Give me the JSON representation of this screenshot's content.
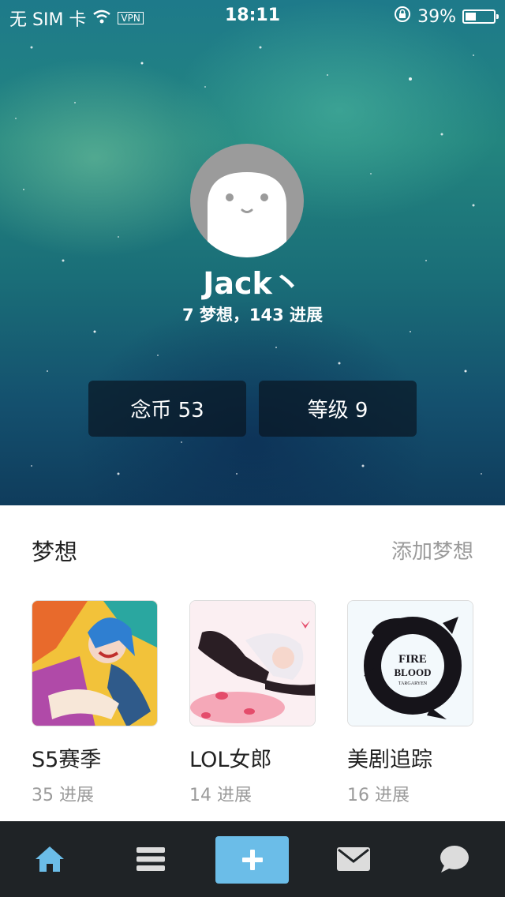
{
  "status_bar": {
    "carrier": "无 SIM 卡",
    "vpn": "VPN",
    "time": "18:11",
    "battery": "39%",
    "battery_level": 0.39
  },
  "profile": {
    "username": "Jack丶",
    "stats": "7 梦想，143 进展",
    "coins_button": "念币 53",
    "level_button": "等级 9"
  },
  "dreams_section": {
    "title": "梦想",
    "add_label": "添加梦想",
    "items": [
      {
        "title": "S5赛季",
        "progress": "35 进展",
        "image": "anime-character-art"
      },
      {
        "title": "LOL女郎",
        "progress": "14 进展",
        "image": "anime-girl-art"
      },
      {
        "title": "美剧追踪",
        "progress": "16 进展",
        "image": "targaryen-sigil"
      }
    ]
  },
  "sigil_text": {
    "line1": "FIRE",
    "line2": "BLOOD",
    "line3": "TARGARYEN"
  },
  "tab_bar": {
    "tabs": [
      "home-icon",
      "menu-icon",
      "plus-icon",
      "mail-icon",
      "chat-icon"
    ],
    "active_color": "#6bbde8",
    "inactive_color": "#dcdcdc"
  },
  "colors": {
    "accent": "#6bbde8",
    "hero_top": "#1e7a8a",
    "hero_bottom": "#0f3c5c"
  }
}
